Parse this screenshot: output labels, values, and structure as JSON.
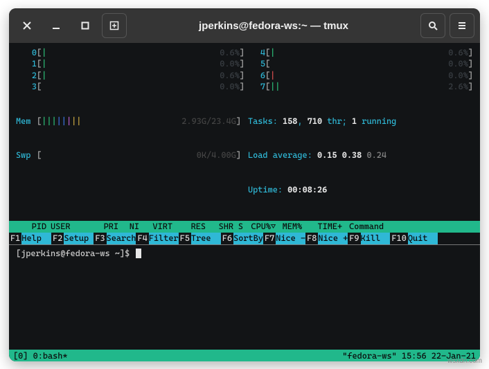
{
  "window": {
    "title": "jperkins@fedora-ws:~ — tmux"
  },
  "cpus": [
    {
      "idx": "0",
      "bar": "|",
      "bar_class": "bar-g",
      "pct": "0.6%"
    },
    {
      "idx": "1",
      "bar": "|",
      "bar_class": "bar-g",
      "pct": "0.0%"
    },
    {
      "idx": "2",
      "bar": "|",
      "bar_class": "bar-g",
      "pct": "0.6%"
    },
    {
      "idx": "3",
      "bar": "",
      "bar_class": "",
      "pct": "0.0%"
    },
    {
      "idx": "4",
      "bar": "|",
      "bar_class": "bar-g",
      "pct": "0.6%"
    },
    {
      "idx": "5",
      "bar": "",
      "bar_class": "",
      "pct": "0.0%"
    },
    {
      "idx": "6",
      "bar": "|",
      "bar_class": "bar-r",
      "pct": "0.0%"
    },
    {
      "idx": "7",
      "bar": "||",
      "bar_class": "bar-g",
      "pct": "2.6%"
    }
  ],
  "mem": {
    "label": "Mem",
    "bar": "||||||||",
    "usage": "2.93G/23.4G"
  },
  "swap": {
    "label": "Swp",
    "bar": "",
    "usage": "0K/4.00G"
  },
  "tasks": {
    "prefix": "Tasks: ",
    "count": "158",
    "sep": ", ",
    "threads": "710",
    "thr_label": " thr; ",
    "running": "1",
    "running_label": " running"
  },
  "load": {
    "prefix": "Load average: ",
    "a": "0.15",
    "b": "0.38",
    "c": "0.24"
  },
  "uptime": {
    "prefix": "Uptime: ",
    "value": "00:08:26"
  },
  "header": {
    "pid": "PID",
    "user": "USER",
    "pri": "PRI",
    "ni": "NI",
    "virt": "VIRT",
    "res": "RES",
    "shr": "SHR",
    "s": "S",
    "cpu": "CPU%",
    "arrow": "▽",
    "mem": "MEM%",
    "time": "TIME+",
    "cmd": "Command"
  },
  "fn": [
    {
      "key": "F1",
      "label": "Help"
    },
    {
      "key": "F2",
      "label": "Setup"
    },
    {
      "key": "F3",
      "label": "Search"
    },
    {
      "key": "F4",
      "label": "Filter"
    },
    {
      "key": "F5",
      "label": "Tree"
    },
    {
      "key": "F6",
      "label": "SortBy"
    },
    {
      "key": "F7",
      "label": "Nice -"
    },
    {
      "key": "F8",
      "label": "Nice +"
    },
    {
      "key": "F9",
      "label": "Kill"
    },
    {
      "key": "F10",
      "label": "Quit"
    }
  ],
  "prompt": "[jperkins@fedora-ws ~]$ ",
  "tmux": {
    "left": "[0] 0:bash*",
    "right": "\"fedora-ws\" 15:56 22-Jan-21"
  },
  "watermark": "wsxdn.com"
}
